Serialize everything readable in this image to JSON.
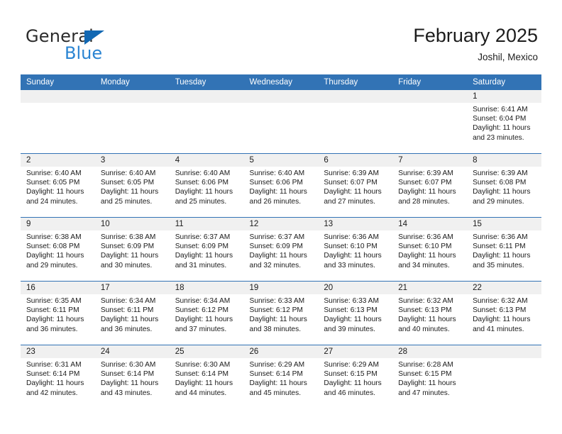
{
  "brand": {
    "name_top": "General",
    "name_bottom": "Blue",
    "triangle_color": "#1268b3",
    "blue_color": "#2a84d2"
  },
  "header": {
    "month_title": "February 2025",
    "location": "Joshil, Mexico"
  },
  "theme": {
    "header_blue": "#3273b5",
    "day_band_gray": "#f0f0f0",
    "cell_white": "#ffffff"
  },
  "calendar": {
    "weekday_headers": [
      "Sunday",
      "Monday",
      "Tuesday",
      "Wednesday",
      "Thursday",
      "Friday",
      "Saturday"
    ],
    "weeks": [
      [
        {
          "day": "",
          "sunrise": "",
          "sunset": "",
          "daylight_line1": "",
          "daylight_line2": "",
          "empty": true
        },
        {
          "day": "",
          "sunrise": "",
          "sunset": "",
          "daylight_line1": "",
          "daylight_line2": "",
          "empty": true
        },
        {
          "day": "",
          "sunrise": "",
          "sunset": "",
          "daylight_line1": "",
          "daylight_line2": "",
          "empty": true
        },
        {
          "day": "",
          "sunrise": "",
          "sunset": "",
          "daylight_line1": "",
          "daylight_line2": "",
          "empty": true
        },
        {
          "day": "",
          "sunrise": "",
          "sunset": "",
          "daylight_line1": "",
          "daylight_line2": "",
          "empty": true
        },
        {
          "day": "",
          "sunrise": "",
          "sunset": "",
          "daylight_line1": "",
          "daylight_line2": "",
          "empty": true
        },
        {
          "day": "1",
          "sunrise": "Sunrise: 6:41 AM",
          "sunset": "Sunset: 6:04 PM",
          "daylight_line1": "Daylight: 11 hours",
          "daylight_line2": "and 23 minutes.",
          "empty": false
        }
      ],
      [
        {
          "day": "2",
          "sunrise": "Sunrise: 6:40 AM",
          "sunset": "Sunset: 6:05 PM",
          "daylight_line1": "Daylight: 11 hours",
          "daylight_line2": "and 24 minutes.",
          "empty": false
        },
        {
          "day": "3",
          "sunrise": "Sunrise: 6:40 AM",
          "sunset": "Sunset: 6:05 PM",
          "daylight_line1": "Daylight: 11 hours",
          "daylight_line2": "and 25 minutes.",
          "empty": false
        },
        {
          "day": "4",
          "sunrise": "Sunrise: 6:40 AM",
          "sunset": "Sunset: 6:06 PM",
          "daylight_line1": "Daylight: 11 hours",
          "daylight_line2": "and 25 minutes.",
          "empty": false
        },
        {
          "day": "5",
          "sunrise": "Sunrise: 6:40 AM",
          "sunset": "Sunset: 6:06 PM",
          "daylight_line1": "Daylight: 11 hours",
          "daylight_line2": "and 26 minutes.",
          "empty": false
        },
        {
          "day": "6",
          "sunrise": "Sunrise: 6:39 AM",
          "sunset": "Sunset: 6:07 PM",
          "daylight_line1": "Daylight: 11 hours",
          "daylight_line2": "and 27 minutes.",
          "empty": false
        },
        {
          "day": "7",
          "sunrise": "Sunrise: 6:39 AM",
          "sunset": "Sunset: 6:07 PM",
          "daylight_line1": "Daylight: 11 hours",
          "daylight_line2": "and 28 minutes.",
          "empty": false
        },
        {
          "day": "8",
          "sunrise": "Sunrise: 6:39 AM",
          "sunset": "Sunset: 6:08 PM",
          "daylight_line1": "Daylight: 11 hours",
          "daylight_line2": "and 29 minutes.",
          "empty": false
        }
      ],
      [
        {
          "day": "9",
          "sunrise": "Sunrise: 6:38 AM",
          "sunset": "Sunset: 6:08 PM",
          "daylight_line1": "Daylight: 11 hours",
          "daylight_line2": "and 29 minutes.",
          "empty": false
        },
        {
          "day": "10",
          "sunrise": "Sunrise: 6:38 AM",
          "sunset": "Sunset: 6:09 PM",
          "daylight_line1": "Daylight: 11 hours",
          "daylight_line2": "and 30 minutes.",
          "empty": false
        },
        {
          "day": "11",
          "sunrise": "Sunrise: 6:37 AM",
          "sunset": "Sunset: 6:09 PM",
          "daylight_line1": "Daylight: 11 hours",
          "daylight_line2": "and 31 minutes.",
          "empty": false
        },
        {
          "day": "12",
          "sunrise": "Sunrise: 6:37 AM",
          "sunset": "Sunset: 6:09 PM",
          "daylight_line1": "Daylight: 11 hours",
          "daylight_line2": "and 32 minutes.",
          "empty": false
        },
        {
          "day": "13",
          "sunrise": "Sunrise: 6:36 AM",
          "sunset": "Sunset: 6:10 PM",
          "daylight_line1": "Daylight: 11 hours",
          "daylight_line2": "and 33 minutes.",
          "empty": false
        },
        {
          "day": "14",
          "sunrise": "Sunrise: 6:36 AM",
          "sunset": "Sunset: 6:10 PM",
          "daylight_line1": "Daylight: 11 hours",
          "daylight_line2": "and 34 minutes.",
          "empty": false
        },
        {
          "day": "15",
          "sunrise": "Sunrise: 6:36 AM",
          "sunset": "Sunset: 6:11 PM",
          "daylight_line1": "Daylight: 11 hours",
          "daylight_line2": "and 35 minutes.",
          "empty": false
        }
      ],
      [
        {
          "day": "16",
          "sunrise": "Sunrise: 6:35 AM",
          "sunset": "Sunset: 6:11 PM",
          "daylight_line1": "Daylight: 11 hours",
          "daylight_line2": "and 36 minutes.",
          "empty": false
        },
        {
          "day": "17",
          "sunrise": "Sunrise: 6:34 AM",
          "sunset": "Sunset: 6:11 PM",
          "daylight_line1": "Daylight: 11 hours",
          "daylight_line2": "and 36 minutes.",
          "empty": false
        },
        {
          "day": "18",
          "sunrise": "Sunrise: 6:34 AM",
          "sunset": "Sunset: 6:12 PM",
          "daylight_line1": "Daylight: 11 hours",
          "daylight_line2": "and 37 minutes.",
          "empty": false
        },
        {
          "day": "19",
          "sunrise": "Sunrise: 6:33 AM",
          "sunset": "Sunset: 6:12 PM",
          "daylight_line1": "Daylight: 11 hours",
          "daylight_line2": "and 38 minutes.",
          "empty": false
        },
        {
          "day": "20",
          "sunrise": "Sunrise: 6:33 AM",
          "sunset": "Sunset: 6:13 PM",
          "daylight_line1": "Daylight: 11 hours",
          "daylight_line2": "and 39 minutes.",
          "empty": false
        },
        {
          "day": "21",
          "sunrise": "Sunrise: 6:32 AM",
          "sunset": "Sunset: 6:13 PM",
          "daylight_line1": "Daylight: 11 hours",
          "daylight_line2": "and 40 minutes.",
          "empty": false
        },
        {
          "day": "22",
          "sunrise": "Sunrise: 6:32 AM",
          "sunset": "Sunset: 6:13 PM",
          "daylight_line1": "Daylight: 11 hours",
          "daylight_line2": "and 41 minutes.",
          "empty": false
        }
      ],
      [
        {
          "day": "23",
          "sunrise": "Sunrise: 6:31 AM",
          "sunset": "Sunset: 6:14 PM",
          "daylight_line1": "Daylight: 11 hours",
          "daylight_line2": "and 42 minutes.",
          "empty": false
        },
        {
          "day": "24",
          "sunrise": "Sunrise: 6:30 AM",
          "sunset": "Sunset: 6:14 PM",
          "daylight_line1": "Daylight: 11 hours",
          "daylight_line2": "and 43 minutes.",
          "empty": false
        },
        {
          "day": "25",
          "sunrise": "Sunrise: 6:30 AM",
          "sunset": "Sunset: 6:14 PM",
          "daylight_line1": "Daylight: 11 hours",
          "daylight_line2": "and 44 minutes.",
          "empty": false
        },
        {
          "day": "26",
          "sunrise": "Sunrise: 6:29 AM",
          "sunset": "Sunset: 6:14 PM",
          "daylight_line1": "Daylight: 11 hours",
          "daylight_line2": "and 45 minutes.",
          "empty": false
        },
        {
          "day": "27",
          "sunrise": "Sunrise: 6:29 AM",
          "sunset": "Sunset: 6:15 PM",
          "daylight_line1": "Daylight: 11 hours",
          "daylight_line2": "and 46 minutes.",
          "empty": false
        },
        {
          "day": "28",
          "sunrise": "Sunrise: 6:28 AM",
          "sunset": "Sunset: 6:15 PM",
          "daylight_line1": "Daylight: 11 hours",
          "daylight_line2": "and 47 minutes.",
          "empty": false
        },
        {
          "day": "",
          "sunrise": "",
          "sunset": "",
          "daylight_line1": "",
          "daylight_line2": "",
          "empty": true
        }
      ]
    ]
  }
}
